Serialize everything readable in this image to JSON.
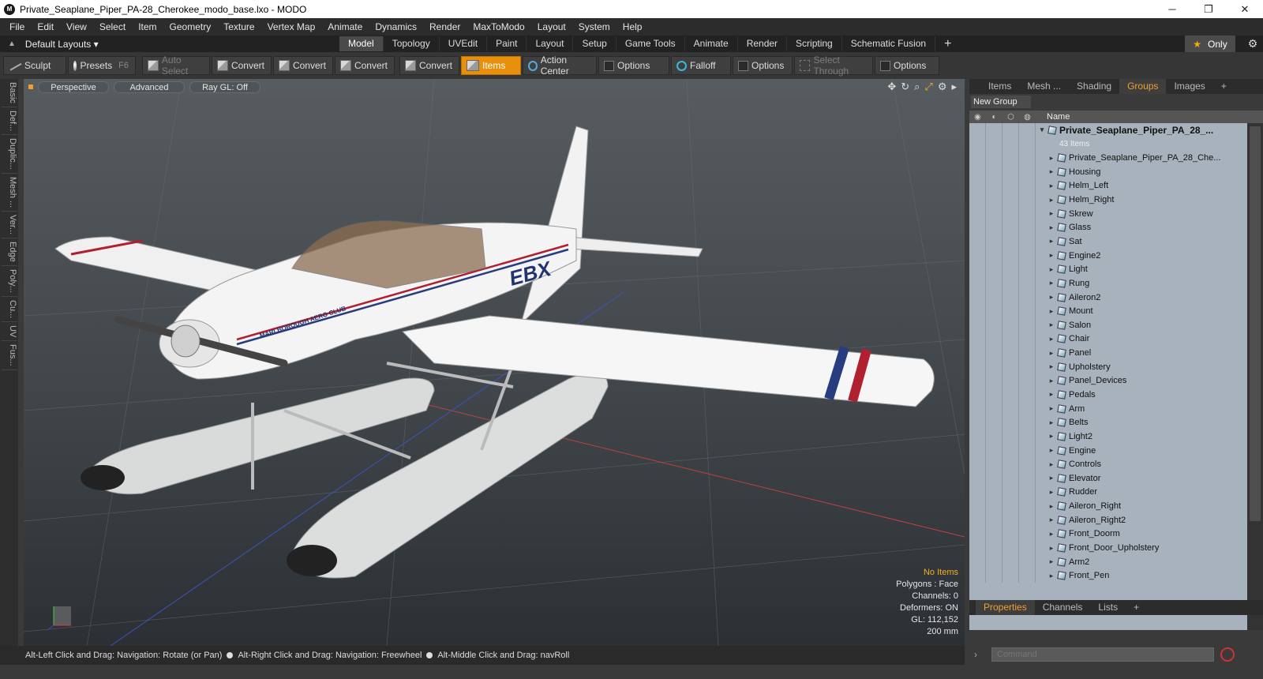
{
  "window": {
    "title": "Private_Seaplane_Piper_PA-28_Cherokee_modo_base.lxo - MODO",
    "icon": "modo-logo-icon",
    "controls": [
      "─",
      "❐",
      "✕"
    ]
  },
  "menu": [
    "File",
    "Edit",
    "View",
    "Select",
    "Item",
    "Geometry",
    "Texture",
    "Vertex Map",
    "Animate",
    "Dynamics",
    "Render",
    "MaxToModo",
    "Layout",
    "System",
    "Help"
  ],
  "layouts": {
    "label": "Default Layouts ▾",
    "tabs": [
      "Model",
      "Topology",
      "UVEdit",
      "Paint",
      "Layout",
      "Setup",
      "Game Tools",
      "Animate",
      "Render",
      "Scripting",
      "Schematic Fusion",
      "+"
    ],
    "active": "Model",
    "only": "Only"
  },
  "toolbar": {
    "sculpt": "Sculpt",
    "presets": "Presets",
    "presets_key": "F6",
    "auto_select": "Auto Select",
    "convert1": "Convert",
    "convert2": "Convert",
    "convert3": "Convert",
    "convert4": "Convert",
    "items": "Items",
    "action_center": "Action Center",
    "options1": "Options",
    "falloff": "Falloff",
    "options2": "Options",
    "select_through": "Select Through",
    "options3": "Options"
  },
  "left_tabs": [
    "Basic",
    "Def...",
    "Duplic...",
    "Mesh ...",
    "Ver...",
    "Edge",
    "Poly...",
    "Cu...",
    "UV",
    "Fus..."
  ],
  "viewport": {
    "view": "Perspective",
    "shading": "Advanced",
    "raygl": "Ray GL: Off",
    "tail_code": "EBX",
    "club": "MARLBOROUGH AERO CLUB",
    "stats": {
      "selection": "No Items",
      "polygons": "Polygons : Face",
      "channels": "Channels: 0",
      "deformers": "Deformers: ON",
      "gl": "GL: 112,152",
      "scale": "200 mm"
    }
  },
  "status": {
    "hint1": "Alt-Left Click and Drag: Navigation: Rotate (or Pan)",
    "hint2": "Alt-Right Click and Drag: Navigation: Freewheel",
    "hint3": "Alt-Middle Click and Drag: navRoll"
  },
  "panel": {
    "tabs": [
      "Items",
      "Mesh ...",
      "Shading",
      "Groups",
      "Images",
      "+"
    ],
    "active": "Groups",
    "new_group": "New Group",
    "name_col": "Name",
    "root": "Private_Seaplane_Piper_PA_28_...",
    "root_count": "43 Items",
    "items": [
      "Private_Seaplane_Piper_PA_28_Che...",
      "Housing",
      "Helm_Left",
      "Helm_Right",
      "Skrew",
      "Glass",
      "Sat",
      "Engine2",
      "Light",
      "Rung",
      "Aileron2",
      "Mount",
      "Salon",
      "Chair",
      "Panel",
      "Upholstery",
      "Panel_Devices",
      "Pedals",
      "Arm",
      "Belts",
      "Light2",
      "Engine",
      "Controls",
      "Elevator",
      "Rudder",
      "Aileron_Right",
      "Aileron_Right2",
      "Front_Doorm",
      "Front_Door_Upholstery",
      "Arm2",
      "Front_Pen"
    ],
    "bottom_tabs": [
      "Properties",
      "Channels",
      "Lists",
      "+"
    ],
    "bottom_active": "Properties",
    "command_placeholder": "Command"
  }
}
